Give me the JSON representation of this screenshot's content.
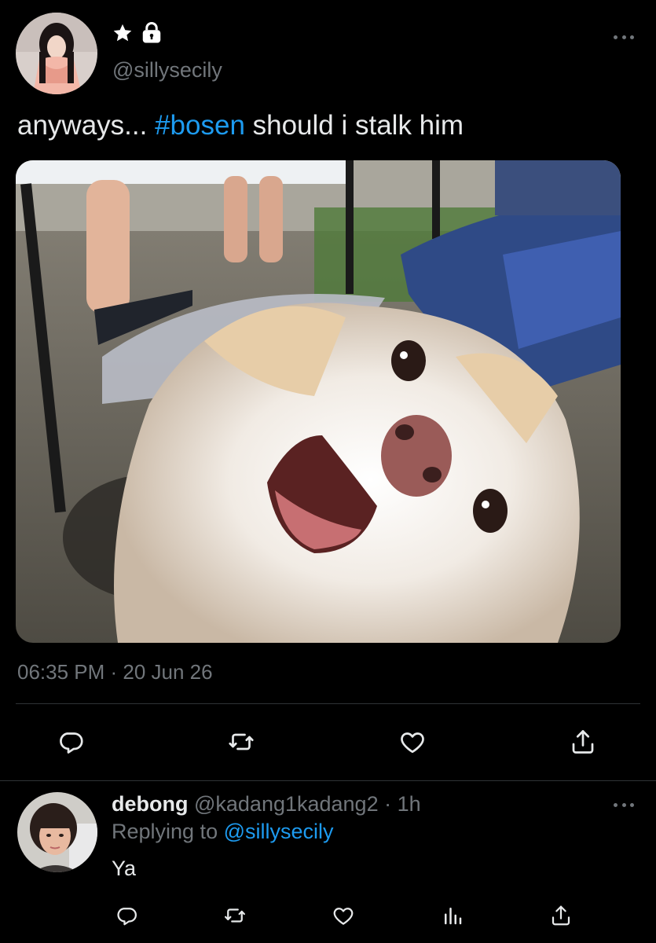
{
  "tweet": {
    "handle": "@sillysecily",
    "text_before": "anyways... ",
    "hashtag": "#bosen",
    "text_after": " should i stalk him",
    "timestamp": "06:35 PM · 20 Jun 26",
    "name_icons": [
      "star-icon",
      "lock-icon"
    ],
    "actions": [
      "reply-icon",
      "retweet-icon",
      "like-icon",
      "share-icon"
    ]
  },
  "reply": {
    "name": "debong",
    "meta": " @kadang1kadang2 · 1h",
    "replying_label": "Replying to ",
    "replying_to": "@sillysecily",
    "text": "Ya",
    "actions": [
      "reply-icon",
      "retweet-icon",
      "like-icon",
      "analytics-icon",
      "share-icon"
    ]
  },
  "colors": {
    "background": "#000000",
    "text": "#e7e9ea",
    "muted": "#71767b",
    "accent": "#1d9bf0",
    "divider": "#2f3336"
  }
}
